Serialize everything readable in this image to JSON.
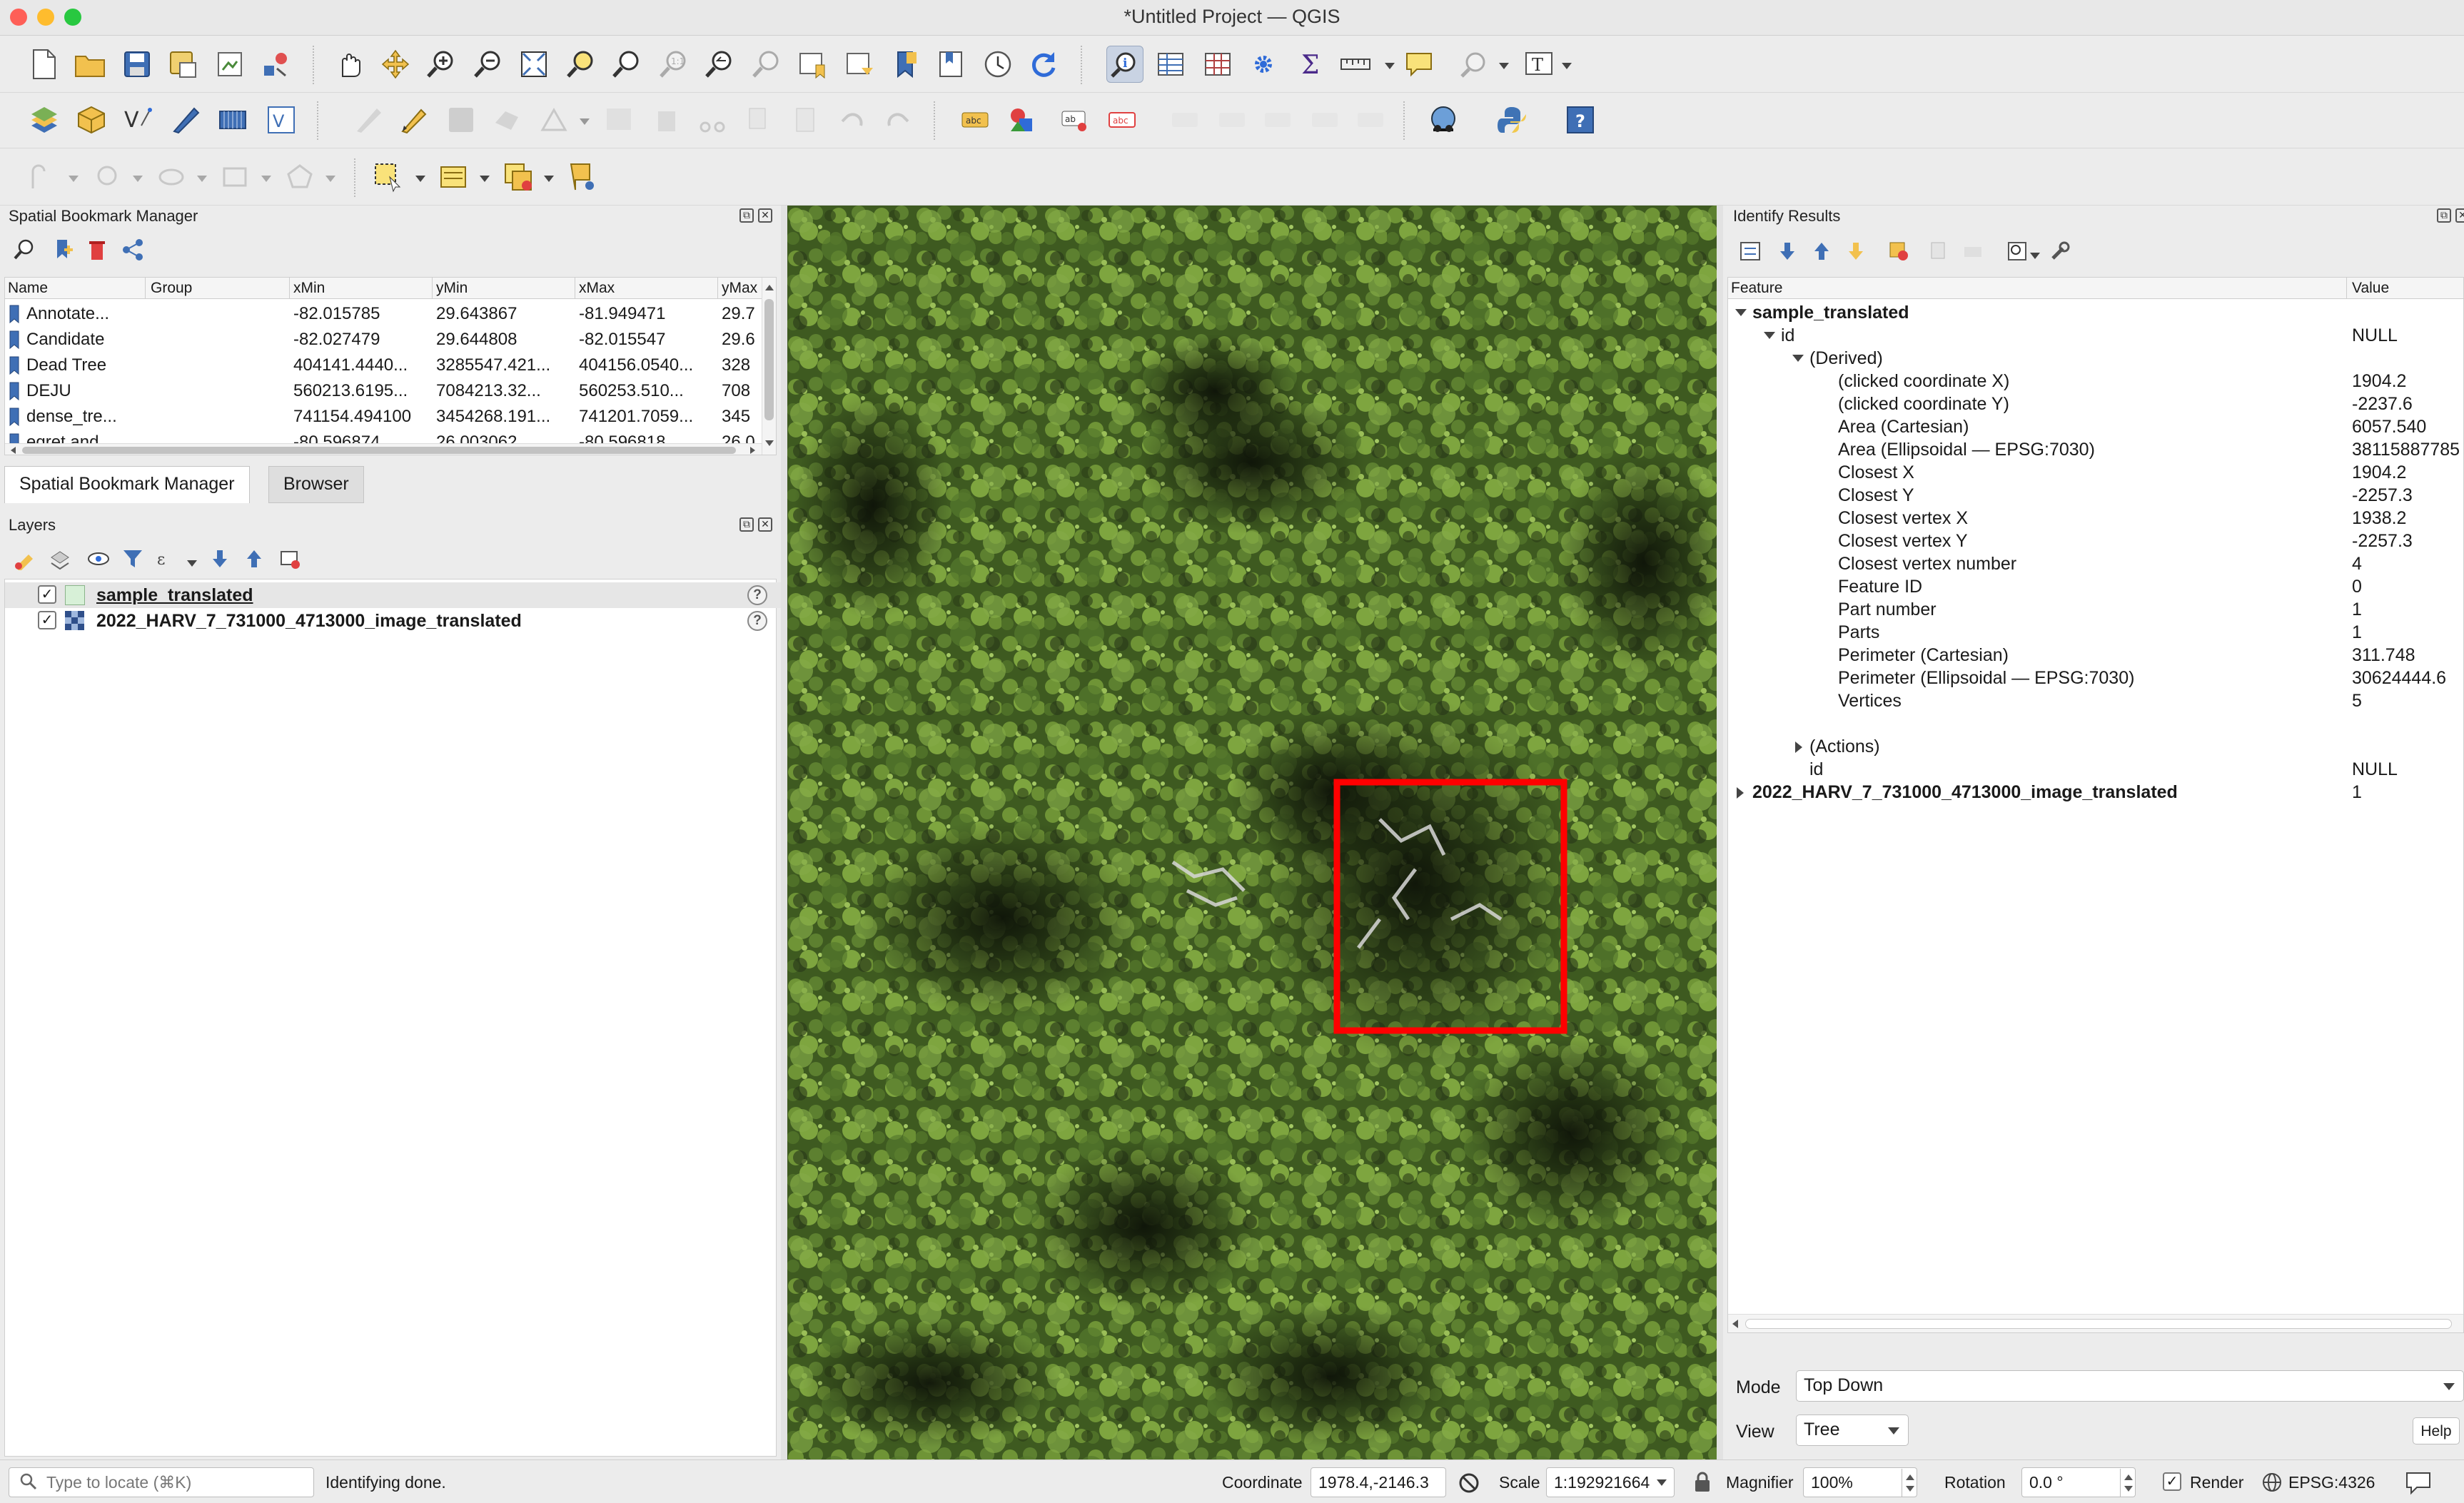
{
  "window": {
    "title": "*Untitled Project — QGIS"
  },
  "colors": {
    "close": "#fe5f57",
    "minimize": "#febc2e",
    "zoom": "#28c840",
    "accent": "#2f6bd8",
    "selection_box": "#ff0000",
    "canopy_light": "#7fa340",
    "canopy_dark": "#1d2a12"
  },
  "toolbar_icons": [
    "new-project-icon",
    "open-project-icon",
    "save-project-icon",
    "save-as-icon",
    "print-layout-icon",
    "style-manager-icon",
    "pan-icon",
    "pan-to-selection-icon",
    "zoom-in-icon",
    "zoom-out-icon",
    "zoom-full-icon",
    "zoom-to-selection-icon",
    "zoom-to-layer-icon",
    "zoom-native-icon",
    "zoom-last-icon",
    "zoom-next-icon",
    "new-bookmark-icon",
    "show-bookmarks-icon",
    "temporal-controller-icon",
    "refresh-icon",
    "identify-icon",
    "attribute-table-icon",
    "statistics-icon",
    "settings-icon",
    "sum-icon",
    "measure-icon",
    "map-tips-icon",
    "select-feature-icon",
    "text-annotation-icon",
    "data-source-manager-icon",
    "new-geopackage-icon",
    "add-vector-icon",
    "digitize-icon",
    "add-raster-icon",
    "vector-tile-icon",
    "edit-pencil-icon",
    "save-edits-icon",
    "label-abc-icon",
    "diagram-icon",
    "python-icon",
    "help-icon"
  ],
  "bookmark_panel": {
    "title": "Spatial Bookmark Manager",
    "columns": [
      "Name",
      "Group",
      "xMin",
      "yMin",
      "xMax",
      "yMax"
    ],
    "rows": [
      {
        "name": "Annotate...",
        "group": "",
        "xmin": "-82.015785",
        "ymin": "29.643867",
        "xmax": "-81.949471",
        "ymax": "29.7"
      },
      {
        "name": "Candidate",
        "group": "",
        "xmin": "-82.027479",
        "ymin": "29.644808",
        "xmax": "-82.015547",
        "ymax": "29.6"
      },
      {
        "name": "Dead Tree",
        "group": "",
        "xmin": "404141.4440...",
        "ymin": "3285547.421...",
        "xmax": "404156.0540...",
        "ymax": "328"
      },
      {
        "name": "DEJU",
        "group": "",
        "xmin": "560213.6195...",
        "ymin": "7084213.32...",
        "xmax": "560253.510...",
        "ymax": "708"
      },
      {
        "name": "dense_tre...",
        "group": "",
        "xmin": "741154.494100",
        "ymin": "3454268.191...",
        "xmax": "741201.7059...",
        "ymax": "345"
      },
      {
        "name": "egret and",
        "group": "",
        "xmin": "-80.596874",
        "ymin": "26.003062",
        "xmax": "-80.596818",
        "ymax": "26.0"
      }
    ]
  },
  "tabs": [
    "Spatial Bookmark Manager",
    "Browser"
  ],
  "layers_panel": {
    "title": "Layers",
    "layers": [
      {
        "name": "sample_translated",
        "checked": "✓"
      },
      {
        "name": "2022_HARV_7_731000_4713000_image_translated",
        "checked": "✓"
      }
    ]
  },
  "identify_panel": {
    "title": "Identify Results",
    "col_feature": "Feature",
    "col_value": "Value",
    "layer1": "sample_translated",
    "id_label": "id",
    "id_value": "NULL",
    "derived_label": "(Derived)",
    "derived": [
      {
        "k": "(clicked coordinate X)",
        "v": "1904.2"
      },
      {
        "k": "(clicked coordinate Y)",
        "v": "-2237.6"
      },
      {
        "k": "Area (Cartesian)",
        "v": "6057.540"
      },
      {
        "k": "Area (Ellipsoidal — EPSG:7030)",
        "v": "38115887785"
      },
      {
        "k": "Closest X",
        "v": "1904.2"
      },
      {
        "k": "Closest Y",
        "v": "-2257.3"
      },
      {
        "k": "Closest vertex X",
        "v": "1938.2"
      },
      {
        "k": "Closest vertex Y",
        "v": "-2257.3"
      },
      {
        "k": "Closest vertex number",
        "v": "4"
      },
      {
        "k": "Feature ID",
        "v": "0"
      },
      {
        "k": "Part number",
        "v": "1"
      },
      {
        "k": "Parts",
        "v": "1"
      },
      {
        "k": "Perimeter (Cartesian)",
        "v": "311.748"
      },
      {
        "k": "Perimeter (Ellipsoidal — EPSG:7030)",
        "v": "30624444.6"
      },
      {
        "k": "Vertices",
        "v": "5"
      }
    ],
    "actions_label": "(Actions)",
    "id2_label": "id",
    "id2_value": "NULL",
    "layer2": "2022_HARV_7_731000_4713000_image_translated",
    "layer2_value": "1",
    "mode_label": "Mode",
    "mode_value": "Top Down",
    "view_label": "View",
    "view_value": "Tree",
    "help_label": "Help"
  },
  "status": {
    "locate_placeholder": "Type to locate (⌘K)",
    "message": "Identifying done.",
    "coordinate_label": "Coordinate",
    "coordinate_value": "1978.4,-2146.3",
    "scale_label": "Scale",
    "scale_value": "1:192921664",
    "magnifier_label": "Magnifier",
    "magnifier_value": "100%",
    "rotation_label": "Rotation",
    "rotation_value": "0.0 °",
    "render_label": "Render",
    "render_checked": "✓",
    "crs": "EPSG:4326"
  }
}
